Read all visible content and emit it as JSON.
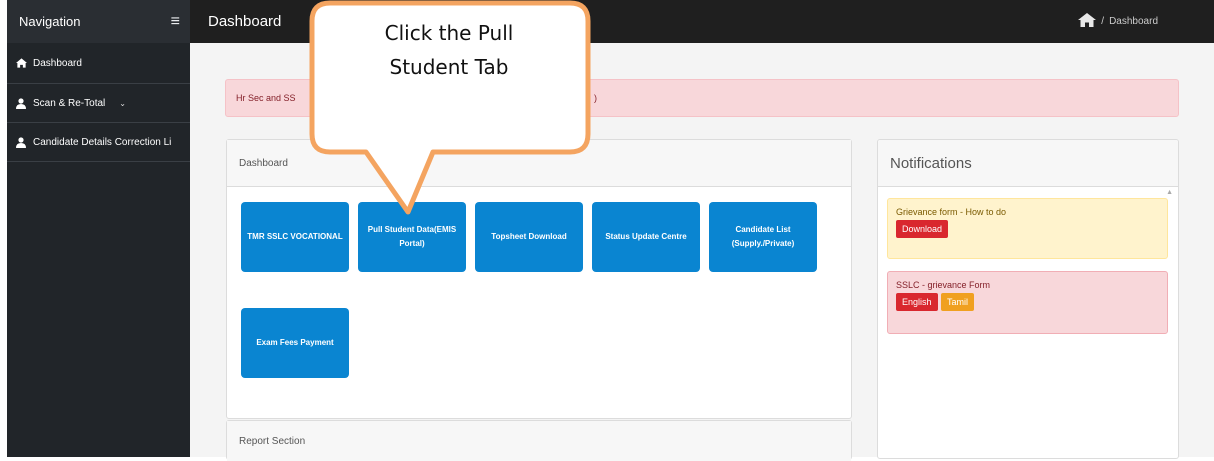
{
  "sidebar": {
    "title": "Navigation",
    "menu_icon": "hamburger-icon",
    "items": [
      {
        "label": "Dashboard",
        "icon": "home-icon"
      },
      {
        "label": "Scan & Re-Total",
        "icon": "user-icon",
        "has_dropdown": true
      },
      {
        "label": "Candidate Details Correction Li",
        "icon": "user-icon"
      }
    ]
  },
  "topbar": {
    "title": "Dashboard",
    "breadcrumb_icon": "home-icon",
    "breadcrumb_separator": "/",
    "breadcrumb_current": "Dashboard"
  },
  "alert": {
    "text": "Hr Sec and SS",
    "tail": ")"
  },
  "dashboard_card": {
    "header": "Dashboard",
    "tiles": [
      "TMR SSLC VOCATIONAL",
      "Pull Student Data(EMIS Portal)",
      "Topsheet Download",
      "Status Update Centre",
      "Candidate List (Supply./Private)",
      "Exam Fees Payment"
    ]
  },
  "report_card": {
    "header": "Report Section"
  },
  "notifications": {
    "header": "Notifications",
    "items": [
      {
        "title": "Grievance form - How to do",
        "buttons": [
          "Download"
        ]
      },
      {
        "title": "SSLC - grievance Form",
        "buttons": [
          "English",
          "Tamil"
        ]
      }
    ]
  },
  "callout": {
    "line1": "Click the Pull",
    "line2": "Student Tab"
  },
  "colors": {
    "tile_blue": "#0a85d1",
    "callout_orange": "#f4a460",
    "alert_pink": "#f8d7da",
    "notice_yellow": "#fff3cd"
  }
}
